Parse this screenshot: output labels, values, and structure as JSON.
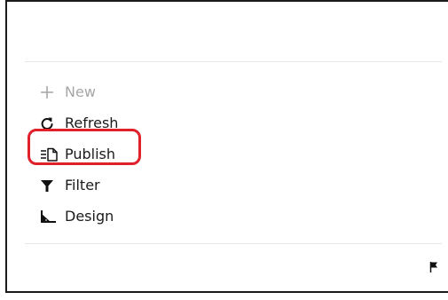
{
  "menu": {
    "items": [
      {
        "label": "New",
        "icon": "plus-icon",
        "disabled": true
      },
      {
        "label": "Refresh",
        "icon": "refresh-icon",
        "disabled": false
      },
      {
        "label": "Publish",
        "icon": "publish-icon",
        "disabled": false
      },
      {
        "label": "Filter",
        "icon": "filter-icon",
        "disabled": false
      },
      {
        "label": "Design",
        "icon": "design-icon",
        "disabled": false
      }
    ]
  },
  "highlight": {
    "target": "Publish",
    "color": "#e0202a"
  },
  "footer": {
    "icon": "flag-icon"
  }
}
